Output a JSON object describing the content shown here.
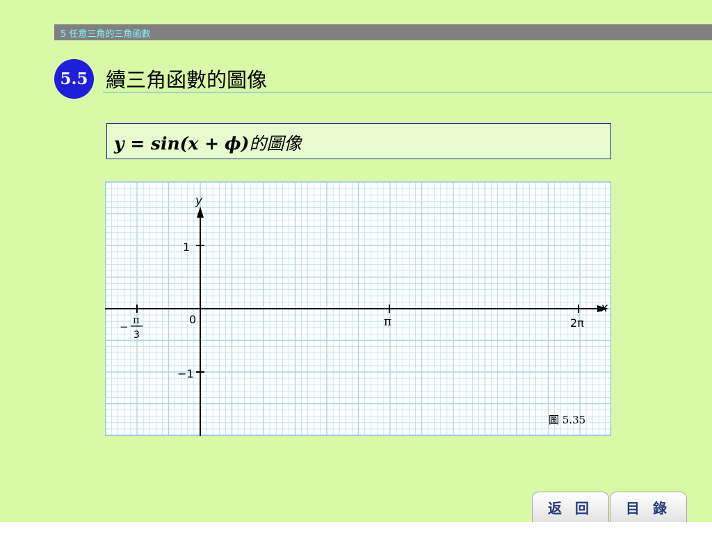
{
  "header": {
    "chapter_label": "5 任意三角的三角函數"
  },
  "section": {
    "number": "5.5",
    "title": "續三角函數的圖像"
  },
  "formula": {
    "math": "y = sin(x +",
    "phi": "ϕ",
    "close": ")",
    "suffix": "的圖像"
  },
  "graph": {
    "x_axis_label": "x",
    "y_axis_label": "y",
    "origin_label": "0",
    "x_ticks": [
      {
        "label": "−π/3",
        "value": -1.0472
      },
      {
        "label": "π",
        "value": 3.1416
      },
      {
        "label": "2π",
        "value": 6.2832
      }
    ],
    "y_ticks": [
      {
        "label": "1",
        "value": 1
      },
      {
        "label": "−1",
        "value": -1
      }
    ],
    "neg_pi3": {
      "minus": "−",
      "num": "π",
      "den": "3"
    },
    "figure_caption": "圖 5.35",
    "grid_color": "#a9d6ea",
    "background": "#ffffff"
  },
  "nav": {
    "back_label": "返 回",
    "contents_label": "目 錄"
  }
}
